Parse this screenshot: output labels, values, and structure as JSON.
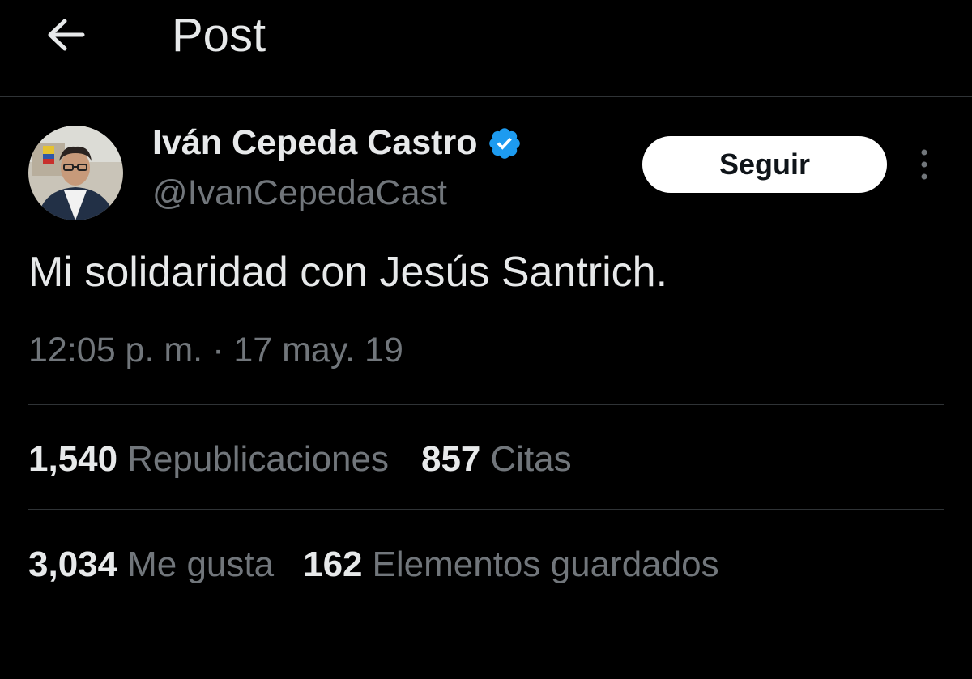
{
  "header": {
    "title": "Post",
    "back_icon": "arrow-left-icon"
  },
  "author": {
    "display_name": "Iván Cepeda Castro",
    "handle": "@IvanCepedaCast",
    "verified_icon": "verified-badge-icon",
    "verified_color": "#1d9bf0"
  },
  "follow_button": {
    "label": "Seguir"
  },
  "more_icon": "more-vertical-icon",
  "tweet": {
    "text": "Mi solidaridad con Jesús Santrich.",
    "timestamp": "12:05 p. m. · 17 may. 19"
  },
  "stats": {
    "reposts": {
      "count": "1,540",
      "label": "Republicaciones"
    },
    "quotes": {
      "count": "857",
      "label": "Citas"
    },
    "likes": {
      "count": "3,034",
      "label": "Me gusta"
    },
    "bookmarks": {
      "count": "162",
      "label": "Elementos guardados"
    }
  },
  "colors": {
    "background": "#000000",
    "text_primary": "#e7e9ea",
    "text_secondary": "#71767b",
    "divider": "#2f3336"
  }
}
